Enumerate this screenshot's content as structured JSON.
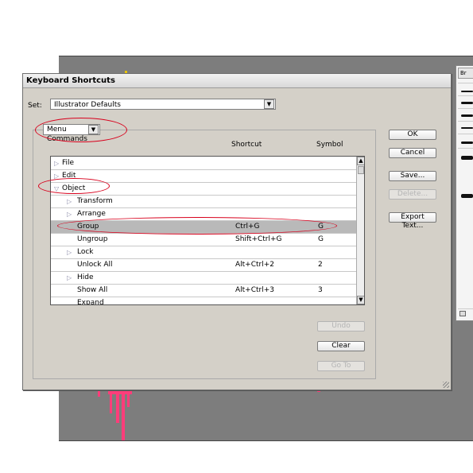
{
  "dialog": {
    "title": "Keyboard Shortcuts",
    "set_label": "Set:",
    "set_value": "Illustrator Defaults",
    "category_value": "Menu Commands",
    "columns": {
      "shortcut": "Shortcut",
      "symbol": "Symbol"
    },
    "rows": [
      {
        "label": "File",
        "shortcut": "",
        "symbol": "",
        "expander": "collapsed",
        "level": 0,
        "selected": false
      },
      {
        "label": "Edit",
        "shortcut": "",
        "symbol": "",
        "expander": "collapsed",
        "level": 0,
        "selected": false
      },
      {
        "label": "Object",
        "shortcut": "",
        "symbol": "",
        "expander": "expanded",
        "level": 0,
        "selected": false
      },
      {
        "label": "Transform",
        "shortcut": "",
        "symbol": "",
        "expander": "collapsed",
        "level": 1,
        "selected": false
      },
      {
        "label": "Arrange",
        "shortcut": "",
        "symbol": "",
        "expander": "collapsed",
        "level": 1,
        "selected": false
      },
      {
        "label": "Group",
        "shortcut": "Ctrl+G",
        "symbol": "G",
        "expander": "none",
        "level": 1,
        "selected": true
      },
      {
        "label": "Ungroup",
        "shortcut": "Shift+Ctrl+G",
        "symbol": "G",
        "expander": "none",
        "level": 1,
        "selected": false
      },
      {
        "label": "Lock",
        "shortcut": "",
        "symbol": "",
        "expander": "collapsed",
        "level": 1,
        "selected": false
      },
      {
        "label": "Unlock All",
        "shortcut": "Alt+Ctrl+2",
        "symbol": "2",
        "expander": "none",
        "level": 1,
        "selected": false
      },
      {
        "label": "Hide",
        "shortcut": "",
        "symbol": "",
        "expander": "collapsed",
        "level": 1,
        "selected": false
      },
      {
        "label": "Show All",
        "shortcut": "Alt+Ctrl+3",
        "symbol": "3",
        "expander": "none",
        "level": 1,
        "selected": false
      },
      {
        "label": "Expand",
        "shortcut": "",
        "symbol": "",
        "expander": "none",
        "level": 1,
        "selected": false
      }
    ],
    "buttons": {
      "ok": "OK",
      "cancel": "Cancel",
      "save": "Save...",
      "delete": "Delete...",
      "export_text": "Export Text...",
      "undo": "Undo",
      "clear": "Clear",
      "go_to": "Go To"
    }
  },
  "brushes_panel": {
    "tab_label": "Br"
  },
  "colors": {
    "dialog_bg": "#d4d0c8",
    "selected_row": "#b9b9b9",
    "annotation": "#d8001c",
    "canvas": "#7d7d7d",
    "artwork_pink": "#ff3d7a"
  }
}
